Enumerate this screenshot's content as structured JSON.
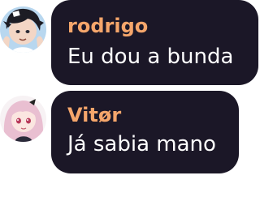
{
  "messages": [
    {
      "author": "rodrigo",
      "text": "Eu dou a bunda",
      "author_color": "#f5a66b",
      "avatar_icon": "anime-boy-avatar-icon"
    },
    {
      "author": "Vitør",
      "text": "Já sabia mano",
      "author_color": "#f5a66b",
      "avatar_icon": "anime-girl-avatar-icon"
    }
  ],
  "colors": {
    "bubble_background": "#1b1727",
    "message_text": "#ffffff",
    "page_background": "#ffffff"
  }
}
